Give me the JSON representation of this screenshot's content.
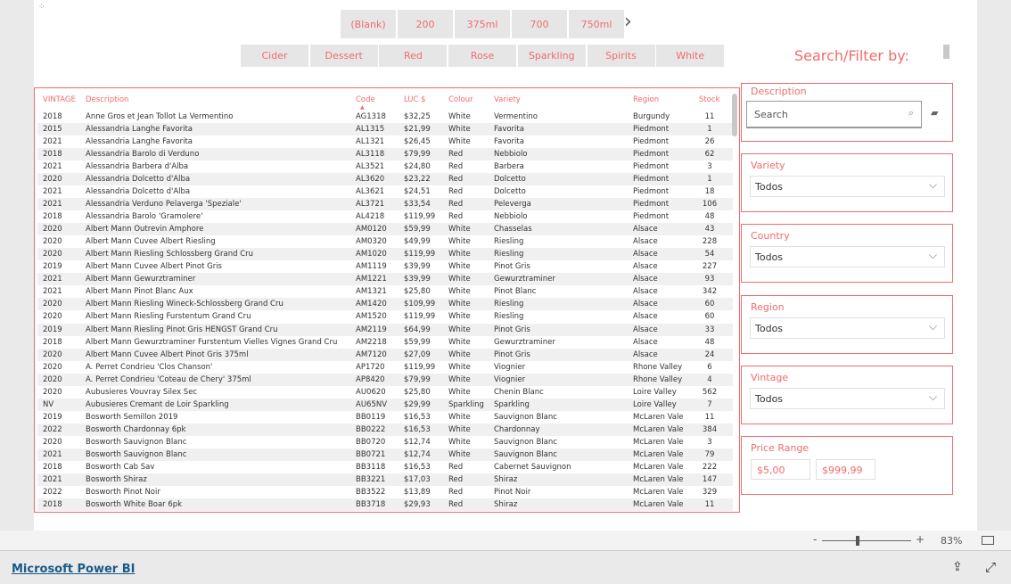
{
  "size_tiles": [
    "(Blank)",
    "200",
    "375ml",
    "700",
    "750ml"
  ],
  "colour_tiles": [
    "Cider",
    "Dessert",
    "Red",
    "Rose",
    "Sparkling",
    "Spirits",
    "White"
  ],
  "search_filter_title": "Search/Filter by:",
  "table": {
    "headers": [
      "VINTAGE",
      "Description",
      "Code",
      "LUC $",
      "Colour",
      "Variety",
      "Region",
      "Stock"
    ],
    "sorted_column": "Code",
    "rows": [
      [
        "2018",
        "Anne Gros et Jean Tollot La Vermentino",
        "AG1318",
        "$32,25",
        "White",
        "Vermentino",
        "Burgundy",
        "11"
      ],
      [
        "2015",
        "Alessandria Langhe Favorita",
        "AL1315",
        "$21,99",
        "White",
        "Favorita",
        "Piedmont",
        "1"
      ],
      [
        "2021",
        "Alessandria Langhe Favorita",
        "AL1321",
        "$26,45",
        "White",
        "Favorita",
        "Piedmont",
        "26"
      ],
      [
        "2018",
        "Alessandria Barolo di Verduno",
        "AL3118",
        "$79,99",
        "Red",
        "Nebbiolo",
        "Piedmont",
        "62"
      ],
      [
        "2021",
        "Alessandria Barbera d'Alba",
        "AL3521",
        "$24,80",
        "Red",
        "Barbera",
        "Piedmont",
        "3"
      ],
      [
        "2020",
        "Alessandria Dolcetto d'Alba",
        "AL3620",
        "$23,22",
        "Red",
        "Dolcetto",
        "Piedmont",
        "1"
      ],
      [
        "2021",
        "Alessandria Dolcetto d'Alba",
        "AL3621",
        "$24,51",
        "Red",
        "Dolcetto",
        "Piedmont",
        "18"
      ],
      [
        "2021",
        "Alessandria Verduno Pelaverga 'Speziale'",
        "AL3721",
        "$33,54",
        "Red",
        "Peleverga",
        "Piedmont",
        "106"
      ],
      [
        "2018",
        "Alessandria Barolo 'Gramolere'",
        "AL4218",
        "$119,99",
        "Red",
        "Nebbiolo",
        "Piedmont",
        "48"
      ],
      [
        "2020",
        "Albert Mann Outrevin Amphore",
        "AM0120",
        "$59,99",
        "White",
        "Chasselas",
        "Alsace",
        "43"
      ],
      [
        "2020",
        "Albert Mann Cuvee Albert Riesling",
        "AM0320",
        "$49,99",
        "White",
        "Riesling",
        "Alsace",
        "228"
      ],
      [
        "2020",
        "Albert Mann Riesling Schlossberg Grand Cru",
        "AM1020",
        "$119,99",
        "White",
        "Riesling",
        "Alsace",
        "54"
      ],
      [
        "2019",
        "Albert Mann Cuvee Albert Pinot Gris",
        "AM1119",
        "$39,99",
        "White",
        "Pinot Gris",
        "Alsace",
        "227"
      ],
      [
        "2021",
        "Albert Mann Gewurztraminer",
        "AM1221",
        "$39,99",
        "White",
        "Gewurztraminer",
        "Alsace",
        "93"
      ],
      [
        "2021",
        "Albert Mann Pinot Blanc Aux",
        "AM1321",
        "$25,80",
        "White",
        "Pinot Blanc",
        "Alsace",
        "342"
      ],
      [
        "2020",
        "Albert Mann Riesling Wineck-Schlossberg Grand Cru",
        "AM1420",
        "$109,99",
        "White",
        "Riesling",
        "Alsace",
        "60"
      ],
      [
        "2020",
        "Albert Mann Riesling Furstentum Grand Cru",
        "AM1520",
        "$119,99",
        "White",
        "Riesling",
        "Alsace",
        "60"
      ],
      [
        "2019",
        "Albert Mann Riesling Pinot Gris HENGST Grand Cru",
        "AM2119",
        "$64,99",
        "White",
        "Pinot Gris",
        "Alsace",
        "33"
      ],
      [
        "2018",
        "Albert Mann Gewurztraminer Furstentum Vielles Vignes Grand Cru",
        "AM2218",
        "$59,99",
        "White",
        "Gewurztraminer",
        "Alsace",
        "48"
      ],
      [
        "2020",
        "Albert Mann Cuvee Albert Pinot Gris 375ml",
        "AM7120",
        "$27,09",
        "White",
        "Pinot Gris",
        "Alsace",
        "24"
      ],
      [
        "2020",
        "A. Perret Condrieu 'Clos Chanson'",
        "AP1720",
        "$119,99",
        "White",
        "Viognier",
        "Rhone Valley",
        "6"
      ],
      [
        "2020",
        "A. Perret Condrieu 'Coteau de Chery' 375ml",
        "AP8420",
        "$79,99",
        "White",
        "Viognier",
        "Rhone Valley",
        "4"
      ],
      [
        "2020",
        "Aubusieres Vouvray Silex Sec",
        "AU0620",
        "$25,80",
        "White",
        "Chenin Blanc",
        "Loire Valley",
        "562"
      ],
      [
        "NV",
        "Aubusieres Cremant de Loir Sparkling",
        "AU65NV",
        "$29,99",
        "Sparkling",
        "Sparkling",
        "Loire Valley",
        "7"
      ],
      [
        "2019",
        "Bosworth Semillon 2019",
        "BB0119",
        "$16,53",
        "White",
        "Sauvignon Blanc",
        "McLaren Vale",
        "11"
      ],
      [
        "2022",
        "Bosworth Chardonnay 6pk",
        "BB0222",
        "$16,53",
        "White",
        "Chardonnay",
        "McLaren Vale",
        "384"
      ],
      [
        "2020",
        "Bosworth Sauvignon Blanc",
        "BB0720",
        "$12,74",
        "White",
        "Sauvignon Blanc",
        "McLaren Vale",
        "3"
      ],
      [
        "2021",
        "Bosworth Sauvignon Blanc",
        "BB0721",
        "$12,74",
        "White",
        "Sauvignon Blanc",
        "McLaren Vale",
        "79"
      ],
      [
        "2018",
        "Bosworth Cab Sav",
        "BB3118",
        "$16,53",
        "Red",
        "Cabernet Sauvignon",
        "McLaren Vale",
        "222"
      ],
      [
        "2021",
        "Bosworth Shiraz",
        "BB3221",
        "$17,03",
        "Red",
        "Shiraz",
        "McLaren Vale",
        "147"
      ],
      [
        "2022",
        "Bosworth Pinot Noir",
        "BB3522",
        "$13,89",
        "Red",
        "Pinot Noir",
        "McLaren Vale",
        "329"
      ],
      [
        "2018",
        "Bosworth White Boar 6pk",
        "BB3718",
        "$29,93",
        "Red",
        "Shiraz",
        "McLaren Vale",
        "11"
      ]
    ]
  },
  "filters": {
    "description": {
      "label": "Description",
      "placeholder": "Search"
    },
    "variety": {
      "label": "Variety",
      "value": "Todos"
    },
    "country": {
      "label": "Country",
      "value": "Todos"
    },
    "region": {
      "label": "Region",
      "value": "Todos"
    },
    "vintage": {
      "label": "Vintage",
      "value": "Todos"
    },
    "price": {
      "label": "Price Range",
      "min": "$5,00",
      "max": "$999,99"
    }
  },
  "zoom": {
    "minus": "-",
    "plus": "+",
    "level": "83%",
    "level_value": 83
  },
  "footer": {
    "brand": "Microsoft Power BI"
  },
  "colors": {
    "accent": "#f26b6b",
    "tile_bg": "#e6e6e6"
  }
}
